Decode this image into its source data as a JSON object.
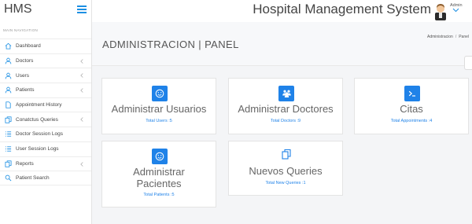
{
  "brand": {
    "title": "HMS"
  },
  "header": {
    "system_title": "Hospital Management System",
    "user_name": "Admin"
  },
  "sidebar": {
    "heading": "MAIN NAVIGATION",
    "items": [
      {
        "label": "Dashboard",
        "icon": "home-icon"
      },
      {
        "label": "Doctors",
        "icon": "user-icon",
        "has_submenu": true
      },
      {
        "label": "Users",
        "icon": "user-icon",
        "has_submenu": true
      },
      {
        "label": "Patients",
        "icon": "user-icon",
        "has_submenu": true
      },
      {
        "label": "Appointment History",
        "icon": "file-icon"
      },
      {
        "label": "Conatctus Queries",
        "icon": "copy-icon",
        "has_submenu": true
      },
      {
        "label": "Doctor Session Logs",
        "icon": "list-icon"
      },
      {
        "label": "User Session Logs",
        "icon": "list-icon"
      },
      {
        "label": "Reports",
        "icon": "copy-icon",
        "has_submenu": true
      },
      {
        "label": "Patient Search",
        "icon": "search-icon"
      }
    ]
  },
  "page": {
    "title": "ADMINISTRACION | PANEL",
    "breadcrumb": [
      "Administracion",
      "Panel"
    ]
  },
  "cards": [
    {
      "title": "Administrar Usuarios",
      "link": "Total Users :5",
      "icon": "smile-icon"
    },
    {
      "title": "Administrar Doctores",
      "link": "Total Doctors :9",
      "icon": "users-icon"
    },
    {
      "title": "Citas",
      "link": "Total Appointments :4",
      "icon": "terminal-icon"
    },
    {
      "title_line1": "Administrar",
      "title_line2": "Pacientes",
      "link": "Total Patients :5",
      "icon": "smile-icon"
    },
    {
      "title": "Nuevos Queries",
      "link": "Total New Queries :1",
      "icon": "copy-icon"
    }
  ],
  "colors": {
    "accent": "#1f82e8",
    "text": "#444444",
    "background": "#f4f5f7"
  }
}
